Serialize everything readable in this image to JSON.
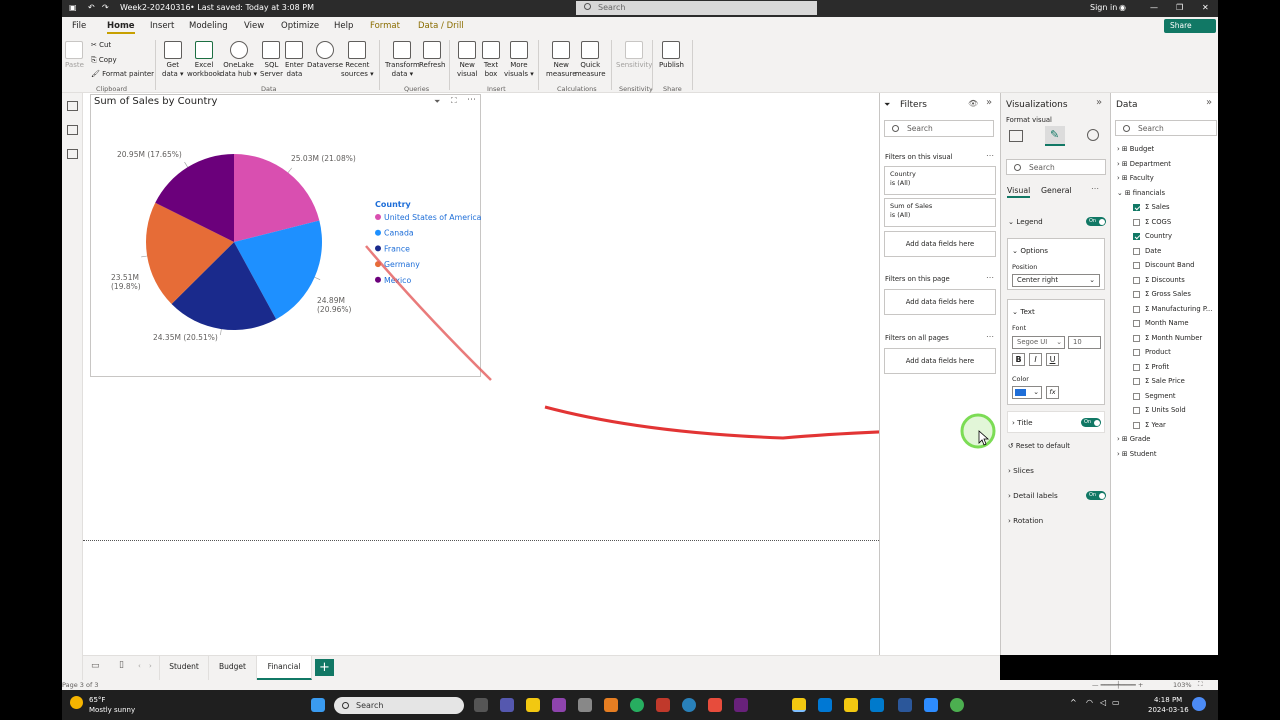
{
  "titlebar": {
    "file_name": "Week2-20240316",
    "saved": "• Last saved: Today at 3:08 PM",
    "search": "Search",
    "sign_in": "Sign in"
  },
  "menu": [
    "File",
    "Home",
    "Insert",
    "Modeling",
    "View",
    "Optimize",
    "Help",
    "Format",
    "Data / Drill"
  ],
  "share": "Share",
  "ribbon": {
    "clipboard": {
      "paste": "Paste",
      "cut": "Cut",
      "copy": "Copy",
      "format_painter": "Format painter",
      "group": "Clipboard"
    },
    "data": [
      {
        "l1": "Get",
        "l2": "data ▾"
      },
      {
        "l1": "Excel",
        "l2": "workbook"
      },
      {
        "l1": "OneLake",
        "l2": "data hub ▾"
      },
      {
        "l1": "SQL",
        "l2": "Server"
      },
      {
        "l1": "Enter",
        "l2": "data"
      },
      {
        "l1": "Dataverse",
        "l2": ""
      },
      {
        "l1": "Recent",
        "l2": "sources ▾"
      }
    ],
    "data_group": "Data",
    "queries": [
      {
        "l1": "Transform",
        "l2": "data ▾"
      },
      {
        "l1": "Refresh",
        "l2": ""
      }
    ],
    "queries_group": "Queries",
    "insert": [
      {
        "l1": "New",
        "l2": "visual"
      },
      {
        "l1": "Text",
        "l2": "box"
      },
      {
        "l1": "More",
        "l2": "visuals ▾"
      }
    ],
    "insert_group": "Insert",
    "calc": [
      {
        "l1": "New",
        "l2": "measure"
      },
      {
        "l1": "Quick",
        "l2": "measure"
      }
    ],
    "calc_group": "Calculations",
    "sens": {
      "l1": "Sensitivity",
      "l2": ""
    },
    "sens_group": "Sensitivity",
    "publish": {
      "l1": "Publish",
      "l2": ""
    },
    "share_group": "Share"
  },
  "visual": {
    "title": "Sum of Sales by Country",
    "legend_title": "Country"
  },
  "chart_data": {
    "type": "pie",
    "title": "Sum of Sales by Country",
    "legend_title": "Country",
    "legend_position": "center-right",
    "slices": [
      {
        "name": "United States of America",
        "value": 25.03,
        "label": "25.03M (21.08%)",
        "color": "#d94fb0"
      },
      {
        "name": "Canada",
        "value": 24.89,
        "label": "24.89M (20.96%)",
        "color": "#1e90ff"
      },
      {
        "name": "France",
        "value": 24.35,
        "label": "24.35M (20.51%)",
        "color": "#1a2a8c"
      },
      {
        "name": "Germany",
        "value": 23.51,
        "label": "23.51M (19.8%)",
        "color": "#e66c37"
      },
      {
        "name": "Mexico",
        "value": 20.95,
        "label": "20.95M (17.65%)",
        "color": "#6b007b"
      }
    ]
  },
  "tabs": [
    "Student",
    "Budget",
    "Financial"
  ],
  "status": {
    "page": "Page 3 of 3",
    "zoom": "103%"
  },
  "filters": {
    "title": "Filters",
    "search": "Search",
    "on_visual": "Filters on this visual",
    "cards": [
      {
        "l1": "Country",
        "l2": "is (All)"
      },
      {
        "l1": "Sum of Sales",
        "l2": "is (All)"
      }
    ],
    "add": "Add data fields here",
    "on_page": "Filters on this page",
    "on_all": "Filters on all pages"
  },
  "viz": {
    "title": "Visualizations",
    "format_visual": "Format visual",
    "search": "Search",
    "tab_visual": "Visual",
    "tab_general": "General",
    "legend": "Legend",
    "on": "On",
    "options": "Options",
    "position_label": "Position",
    "position_value": "Center right",
    "text": "Text",
    "font_label": "Font",
    "font_value": "Segoe UI",
    "font_size": "10",
    "bold": "B",
    "italic": "I",
    "underline": "U",
    "color_label": "Color",
    "fx": "fx",
    "title_section": "Title",
    "reset": "Reset to default",
    "slices": "Slices",
    "detail_labels": "Detail labels",
    "rotation": "Rotation"
  },
  "data": {
    "title": "Data",
    "search": "Search",
    "tables": [
      "Budget",
      "Department",
      "Faculty",
      "financials"
    ],
    "fields": [
      {
        "name": "Sales",
        "sigma": true,
        "checked": true
      },
      {
        "name": "COGS",
        "sigma": true,
        "checked": false
      },
      {
        "name": "Country",
        "sigma": false,
        "checked": true
      },
      {
        "name": "Date",
        "sigma": false,
        "checked": false
      },
      {
        "name": "Discount Band",
        "sigma": false,
        "checked": false
      },
      {
        "name": "Discounts",
        "sigma": true,
        "checked": false
      },
      {
        "name": "Gross Sales",
        "sigma": true,
        "checked": false
      },
      {
        "name": "Manufacturing P...",
        "sigma": true,
        "checked": false
      },
      {
        "name": "Month Name",
        "sigma": false,
        "checked": false
      },
      {
        "name": "Month Number",
        "sigma": true,
        "checked": false
      },
      {
        "name": "Product",
        "sigma": false,
        "checked": false
      },
      {
        "name": "Profit",
        "sigma": true,
        "checked": false
      },
      {
        "name": "Sale Price",
        "sigma": true,
        "checked": false
      },
      {
        "name": "Segment",
        "sigma": false,
        "checked": false
      },
      {
        "name": "Units Sold",
        "sigma": true,
        "checked": false
      },
      {
        "name": "Year",
        "sigma": true,
        "checked": false
      }
    ],
    "tables_after": [
      "Grade",
      "Student"
    ]
  },
  "taskbar": {
    "temp": "65°F",
    "weather": "Mostly sunny",
    "search": "Search",
    "time": "4:18 PM",
    "date": "2024-03-16"
  }
}
